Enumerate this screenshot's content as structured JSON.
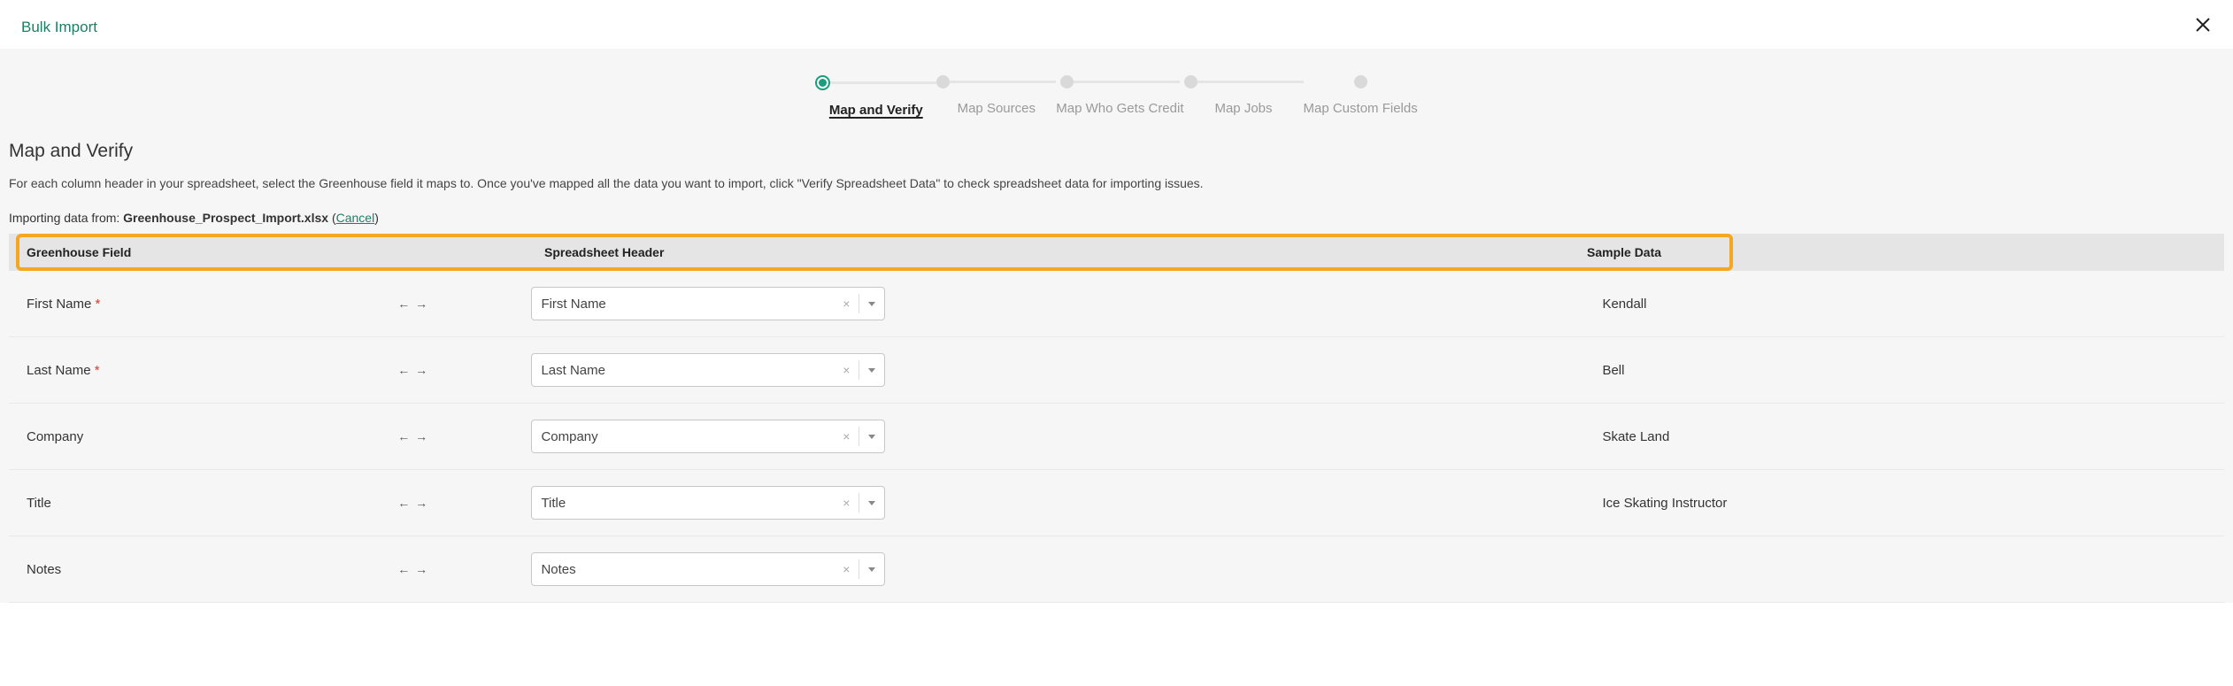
{
  "modal_title": "Bulk Import",
  "stepper": {
    "steps": [
      {
        "label": "Map and Verify",
        "active": true
      },
      {
        "label": "Map Sources",
        "active": false
      },
      {
        "label": "Map Who Gets Credit",
        "active": false
      },
      {
        "label": "Map Jobs",
        "active": false
      },
      {
        "label": "Map Custom Fields",
        "active": false
      }
    ]
  },
  "section_title": "Map and Verify",
  "description": "For each column header in your spreadsheet, select the Greenhouse field it maps to. Once you've mapped all the data you want to import, click \"Verify Spreadsheet Data\" to check spreadsheet data for importing issues.",
  "import_prefix": "Importing data from: ",
  "import_file": "Greenhouse_Prospect_Import.xlsx",
  "cancel_label": "Cancel",
  "table_headers": {
    "field": "Greenhouse Field",
    "header": "Spreadsheet Header",
    "sample": "Sample Data"
  },
  "arrows_glyph": "← →",
  "rows": [
    {
      "field": "First Name",
      "required": true,
      "header": "First Name",
      "sample": "Kendall"
    },
    {
      "field": "Last Name",
      "required": true,
      "header": "Last Name",
      "sample": "Bell"
    },
    {
      "field": "Company",
      "required": false,
      "header": "Company",
      "sample": "Skate Land"
    },
    {
      "field": "Title",
      "required": false,
      "header": "Title",
      "sample": "Ice Skating Instructor"
    },
    {
      "field": "Notes",
      "required": false,
      "header": "Notes",
      "sample": ""
    }
  ]
}
